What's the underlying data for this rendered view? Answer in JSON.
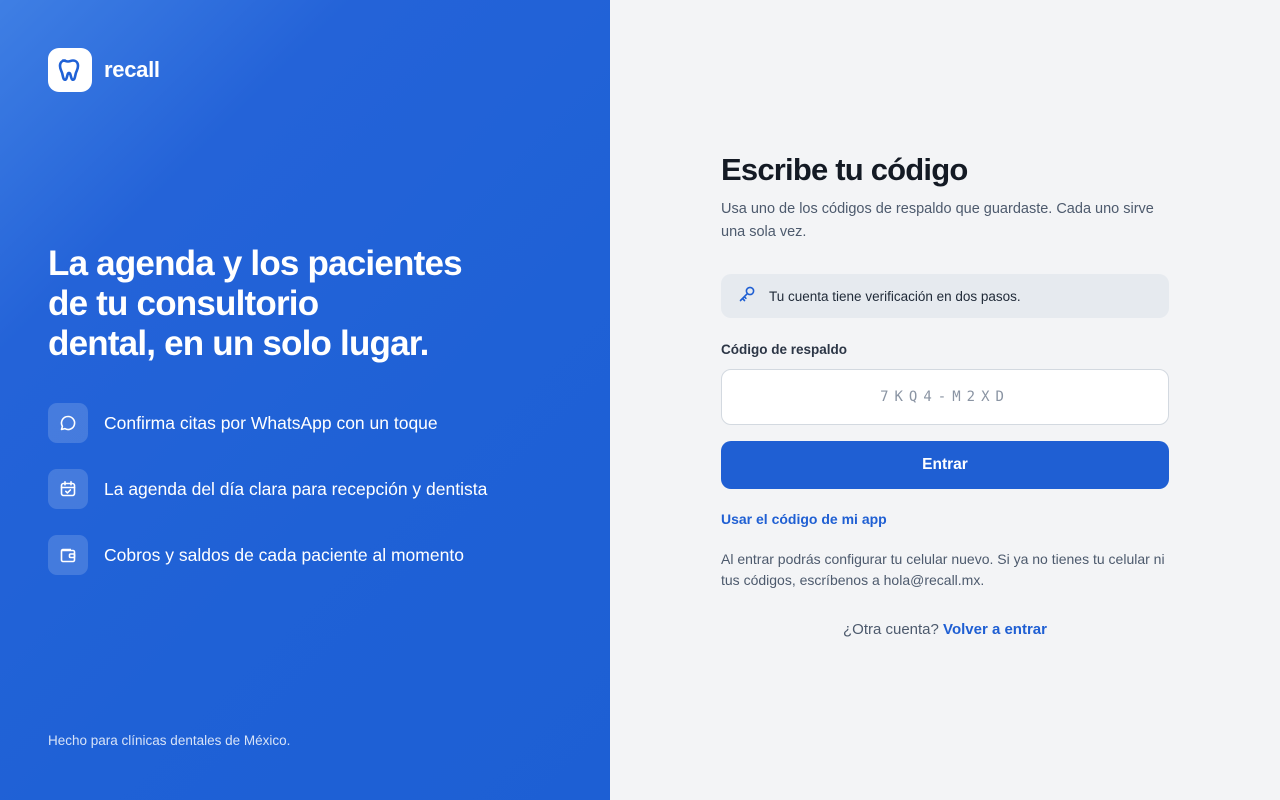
{
  "brand": {
    "name": "recall",
    "logo_icon": "tooth-icon"
  },
  "hero": {
    "headline_lines": [
      "La agenda y los pacientes",
      "de tu consultorio",
      "dental, en un solo lugar."
    ]
  },
  "features": [
    {
      "icon": "chat-icon",
      "text": "Confirma citas por WhatsApp con un toque"
    },
    {
      "icon": "calendar-check-icon",
      "text": "La agenda del día clara para recepción y dentista"
    },
    {
      "icon": "wallet-icon",
      "text": "Cobros y saldos de cada paciente al momento"
    }
  ],
  "left_footer": "Hecho para clínicas dentales de México.",
  "form": {
    "title": "Escribe tu código",
    "subtitle": "Usa uno de los códigos de respaldo que guardaste. Cada uno sirve una sola vez.",
    "notice": {
      "icon": "key-icon",
      "text": "Tu cuenta tiene verificación en dos pasos."
    },
    "field_label": "Código de respaldo",
    "field_value": "",
    "field_placeholder": "7KQ4-M2XD",
    "submit_label": "Entrar",
    "alt_link": "Usar el código de mi app",
    "help_text": "Al entrar podrás configurar tu celular nuevo. Si ya no tienes tu celular ni tus códigos, escríbenos a hola@recall.mx.",
    "switch_prompt": "¿Otra cuenta?",
    "switch_link": "Volver a entrar"
  },
  "colors": {
    "primary": "#1f5fd3",
    "panel_blue": "#1f61d6",
    "background": "#f3f4f6",
    "title": "#141a24"
  }
}
